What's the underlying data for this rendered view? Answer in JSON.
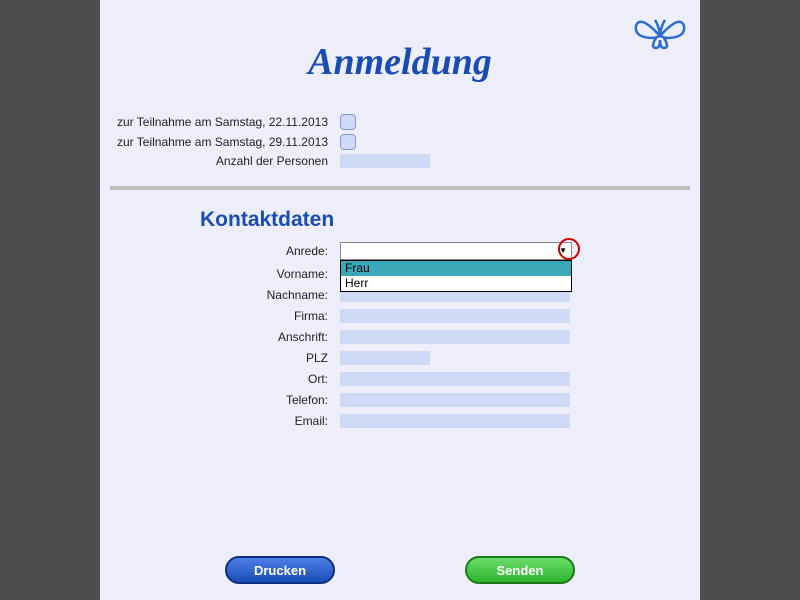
{
  "title": "Anmeldung",
  "top": {
    "saturday1": "zur Teilnahme am Samstag, 22.11.2013",
    "saturday2": "zur Teilnahme am Samstag, 29.11.2013",
    "persons": "Anzahl der Personen"
  },
  "section": "Kontaktdaten",
  "labels": {
    "anrede": "Anrede:",
    "vorname": "Vorname:",
    "nachname": "Nachname:",
    "firma": "Firma:",
    "anschrift": "Anschrift:",
    "plz": "PLZ",
    "ort": "Ort:",
    "telefon": "Telefon:",
    "email": "Email:"
  },
  "anrede_value": "",
  "anrede_options": {
    "frau": "Frau",
    "herr": "Herr"
  },
  "buttons": {
    "print": "Drucken",
    "send": "Senden"
  }
}
